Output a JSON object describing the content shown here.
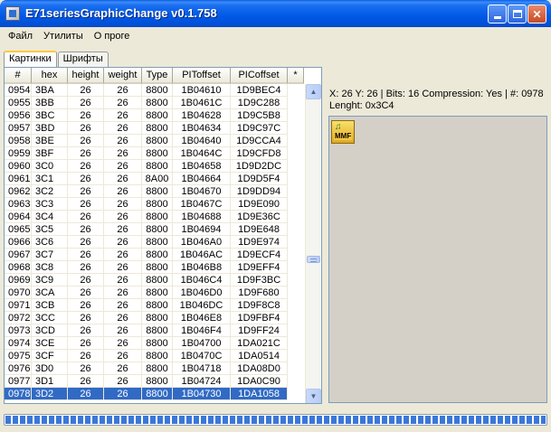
{
  "window": {
    "title": "E71seriesGraphicChange v0.1.758"
  },
  "menu": {
    "items": [
      "Файл",
      "Утилиты",
      "О проге"
    ]
  },
  "tabs": [
    {
      "label": "Картинки",
      "active": true
    },
    {
      "label": "Шрифты",
      "active": false
    }
  ],
  "table": {
    "columns": [
      "#",
      "hex",
      "height",
      "weight",
      "Type",
      "PIToffset",
      "PICoffset",
      "*"
    ],
    "rows": [
      [
        "0954",
        "3BA",
        "26",
        "26",
        "8800",
        "1B04610",
        "1D9BEC4"
      ],
      [
        "0955",
        "3BB",
        "26",
        "26",
        "8800",
        "1B0461C",
        "1D9C288"
      ],
      [
        "0956",
        "3BC",
        "26",
        "26",
        "8800",
        "1B04628",
        "1D9C5B8"
      ],
      [
        "0957",
        "3BD",
        "26",
        "26",
        "8800",
        "1B04634",
        "1D9C97C"
      ],
      [
        "0958",
        "3BE",
        "26",
        "26",
        "8800",
        "1B04640",
        "1D9CCA4"
      ],
      [
        "0959",
        "3BF",
        "26",
        "26",
        "8800",
        "1B0464C",
        "1D9CFD8"
      ],
      [
        "0960",
        "3C0",
        "26",
        "26",
        "8800",
        "1B04658",
        "1D9D2DC"
      ],
      [
        "0961",
        "3C1",
        "26",
        "26",
        "8A00",
        "1B04664",
        "1D9D5F4"
      ],
      [
        "0962",
        "3C2",
        "26",
        "26",
        "8800",
        "1B04670",
        "1D9DD94"
      ],
      [
        "0963",
        "3C3",
        "26",
        "26",
        "8800",
        "1B0467C",
        "1D9E090"
      ],
      [
        "0964",
        "3C4",
        "26",
        "26",
        "8800",
        "1B04688",
        "1D9E36C"
      ],
      [
        "0965",
        "3C5",
        "26",
        "26",
        "8800",
        "1B04694",
        "1D9E648"
      ],
      [
        "0966",
        "3C6",
        "26",
        "26",
        "8800",
        "1B046A0",
        "1D9E974"
      ],
      [
        "0967",
        "3C7",
        "26",
        "26",
        "8800",
        "1B046AC",
        "1D9ECF4"
      ],
      [
        "0968",
        "3C8",
        "26",
        "26",
        "8800",
        "1B046B8",
        "1D9EFF4"
      ],
      [
        "0969",
        "3C9",
        "26",
        "26",
        "8800",
        "1B046C4",
        "1D9F3BC"
      ],
      [
        "0970",
        "3CA",
        "26",
        "26",
        "8800",
        "1B046D0",
        "1D9F680"
      ],
      [
        "0971",
        "3CB",
        "26",
        "26",
        "8800",
        "1B046DC",
        "1D9F8C8"
      ],
      [
        "0972",
        "3CC",
        "26",
        "26",
        "8800",
        "1B046E8",
        "1D9FBF4"
      ],
      [
        "0973",
        "3CD",
        "26",
        "26",
        "8800",
        "1B046F4",
        "1D9FF24"
      ],
      [
        "0974",
        "3CE",
        "26",
        "26",
        "8800",
        "1B04700",
        "1DA021C"
      ],
      [
        "0975",
        "3CF",
        "26",
        "26",
        "8800",
        "1B0470C",
        "1DA0514"
      ],
      [
        "0976",
        "3D0",
        "26",
        "26",
        "8800",
        "1B04718",
        "1DA08D0"
      ],
      [
        "0977",
        "3D1",
        "26",
        "26",
        "8800",
        "1B04724",
        "1DA0C90"
      ],
      [
        "0978",
        "3D2",
        "26",
        "26",
        "8800",
        "1B04730",
        "1DA1058"
      ]
    ],
    "selected_row": "0978"
  },
  "info": {
    "line1": "X: 26 Y: 26 | Bits: 16 Compression: Yes | #: 0978",
    "line2": "Lenght: 0x3C4"
  },
  "preview": {
    "icon": "mmf-file-icon",
    "badge_text": "MMF"
  },
  "colors": {
    "selection": "#316ac5",
    "titlebar": "#0058e6",
    "progress": "#3c77d8"
  },
  "progress": {
    "value": 1.0
  }
}
